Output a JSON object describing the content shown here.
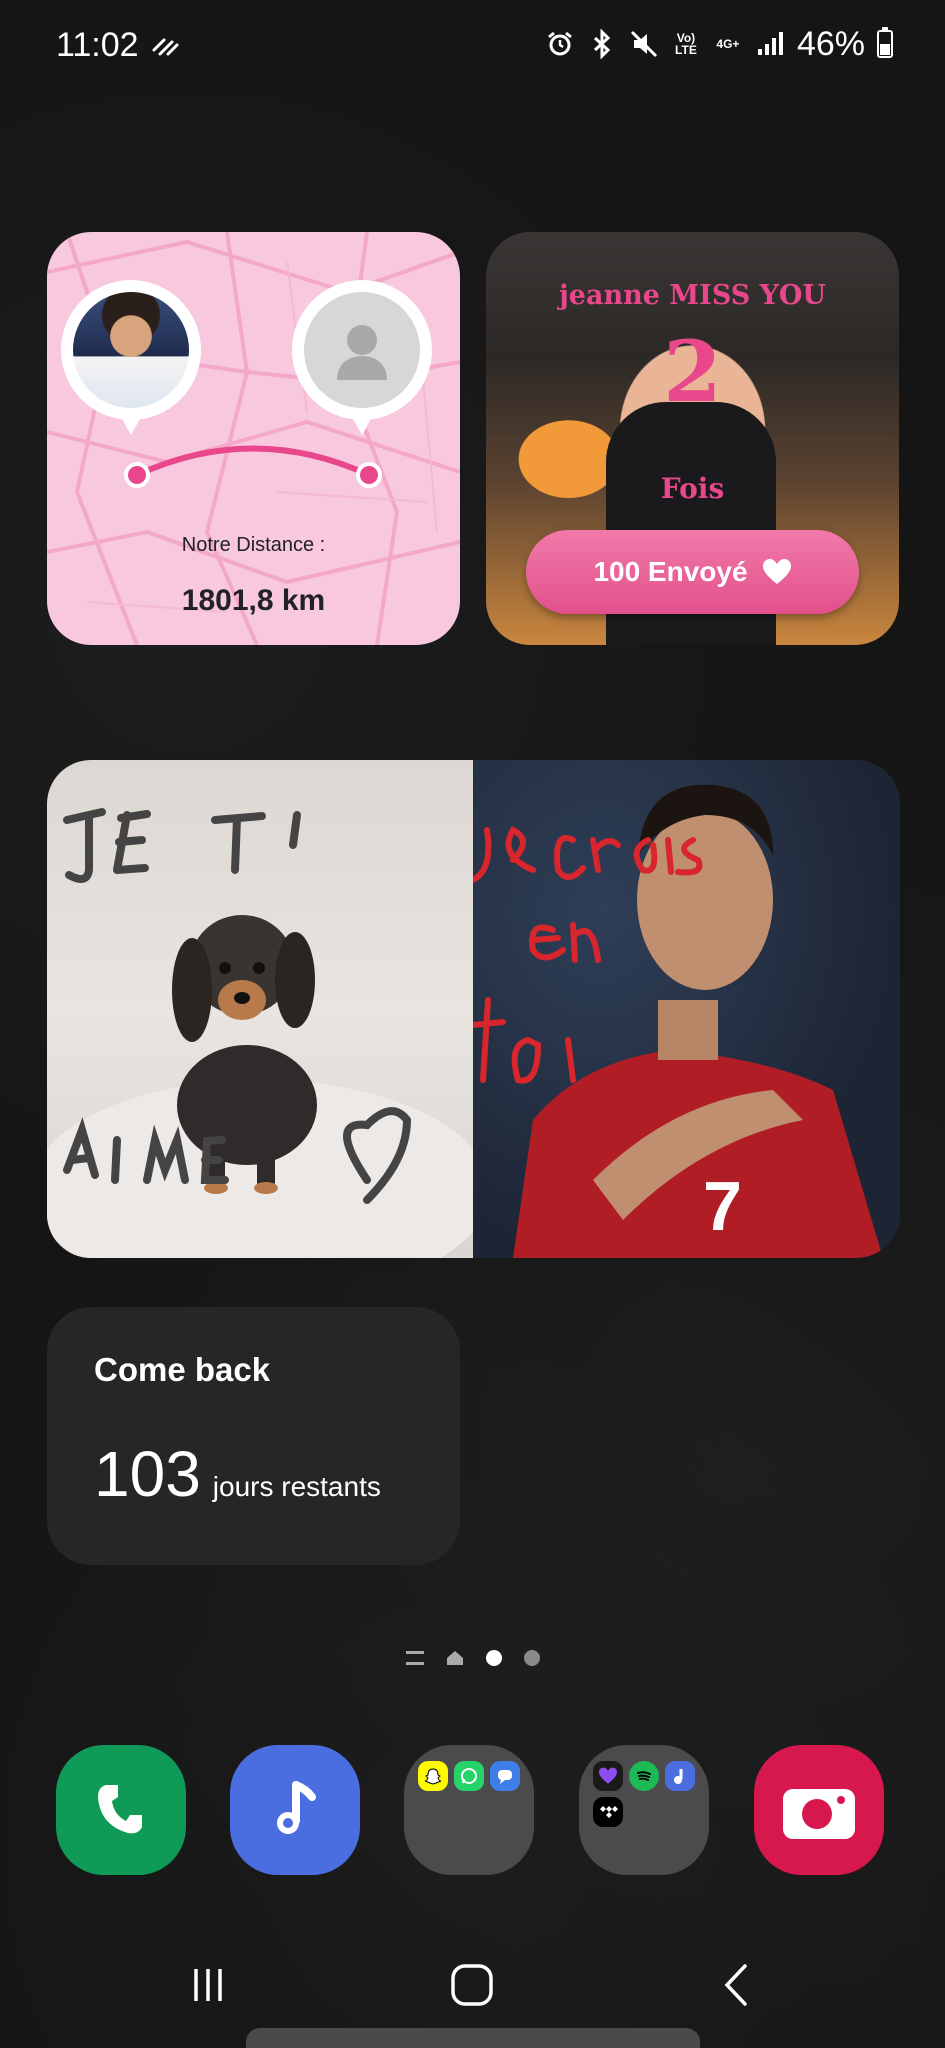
{
  "status_bar": {
    "time": "11:02",
    "battery_percent": "46%",
    "battery_level": 0.46,
    "network_volte": "Vo)\nLTE",
    "network_4g": "4G+",
    "icons": [
      "data-saver-icon",
      "alarm-icon",
      "bluetooth-icon",
      "mute-icon",
      "volte-icon",
      "4g-plus-icon",
      "signal-icon",
      "battery-icon"
    ]
  },
  "distance_widget": {
    "label": "Notre Distance :",
    "value": "1801,8 km",
    "accent": "#e9478c"
  },
  "miss_widget": {
    "title": "jeanne MISS YOU",
    "count": "2",
    "unit": "Fois",
    "button_label": "100 Envoyé",
    "accent": "#e9478c"
  },
  "photo_widget": {
    "left_scribble": "JE T'",
    "left_scribble_bottom": "AIME",
    "right_scribble": "je crois en toi"
  },
  "countdown_widget": {
    "title": "Come back",
    "number": "103",
    "unit": "jours restants"
  },
  "page_indicator": {
    "pages": 2,
    "active_index": 0
  },
  "dock": {
    "apps": [
      {
        "name": "phone-app",
        "color": "#0f9a58"
      },
      {
        "name": "music-app",
        "color": "#4a6ee0"
      },
      {
        "name": "social-folder",
        "apps": [
          "snapchat",
          "whatsapp",
          "messages"
        ]
      },
      {
        "name": "music-folder",
        "apps": [
          "purple-heart",
          "spotify",
          "samsung-music",
          "tidal"
        ]
      },
      {
        "name": "camera-app",
        "color": "#d7184f"
      }
    ]
  },
  "nav_bar": {
    "buttons": [
      "recents",
      "home",
      "back"
    ]
  }
}
